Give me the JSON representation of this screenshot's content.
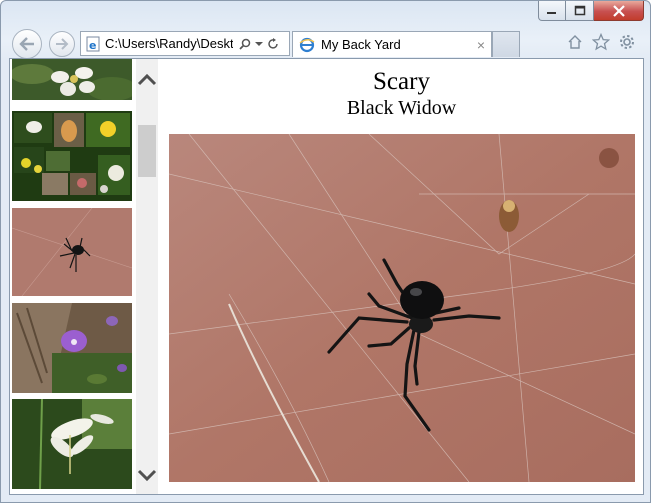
{
  "browser": {
    "address": "C:\\Users\\Randy\\Deskt",
    "tab_title": "My Back Yard",
    "tab_close": "×"
  },
  "page": {
    "title": "Scary",
    "subtitle": "Black Widow"
  },
  "sidebar": {
    "thumbnails": [
      {
        "name": "white-flower-thumbnail"
      },
      {
        "name": "flower-collage-thumbnail"
      },
      {
        "name": "black-widow-thumbnail"
      },
      {
        "name": "purple-violet-thumbnail"
      },
      {
        "name": "white-lily-thumbnail"
      }
    ]
  },
  "colors": {
    "frame": "#dbe6f3",
    "close_button": "#c75050",
    "wall": "#b3786d"
  }
}
